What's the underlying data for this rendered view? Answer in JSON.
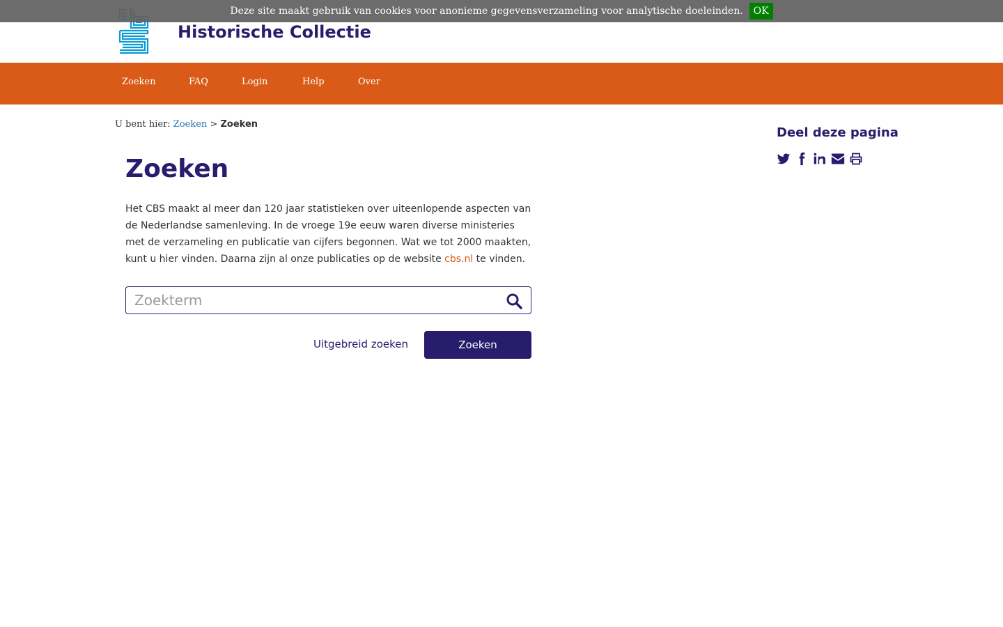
{
  "cookie_bar": {
    "message": "Deze site maakt gebruik van cookies voor anonieme gegevensverzameling voor analytische doeleinden.",
    "ok_label": "OK"
  },
  "header": {
    "site_title": "Historische Collectie",
    "logo_icon": "cbs-logo-icon"
  },
  "nav": {
    "items": [
      {
        "label": "Zoeken"
      },
      {
        "label": "FAQ"
      },
      {
        "label": "Login"
      },
      {
        "label": "Help"
      },
      {
        "label": "Over"
      }
    ]
  },
  "breadcrumb": {
    "prefix": "U bent hier:",
    "link": "Zoeken",
    "separator": ">",
    "current": "Zoeken"
  },
  "main": {
    "title": "Zoeken",
    "intro_before": "Het CBS maakt al meer dan 120 jaar statistieken over uiteenlopende aspecten van de Nederlandse samenleving. In de vroege 19e eeuw waren diverse ministeries met de verzameling en publicatie van cijfers begonnen. Wat we tot 2000 maakten, kunt u hier vinden. Daarna zijn al onze publicaties op de website ",
    "intro_link": "cbs.nl",
    "intro_after": " te vinden.",
    "search_placeholder": "Zoekterm",
    "search_value": "",
    "advanced_label": "Uitgebreid zoeken",
    "search_button_label": "Zoeken"
  },
  "share": {
    "title": "Deel deze pagina",
    "icons": [
      "twitter-icon",
      "facebook-icon",
      "linkedin-icon",
      "envelope-icon",
      "print-icon"
    ]
  },
  "colors": {
    "brand_dark": "#271d6c",
    "nav_orange": "#d95b17",
    "link_blue": "#2275b6",
    "cookie_ok_green": "#008000"
  }
}
